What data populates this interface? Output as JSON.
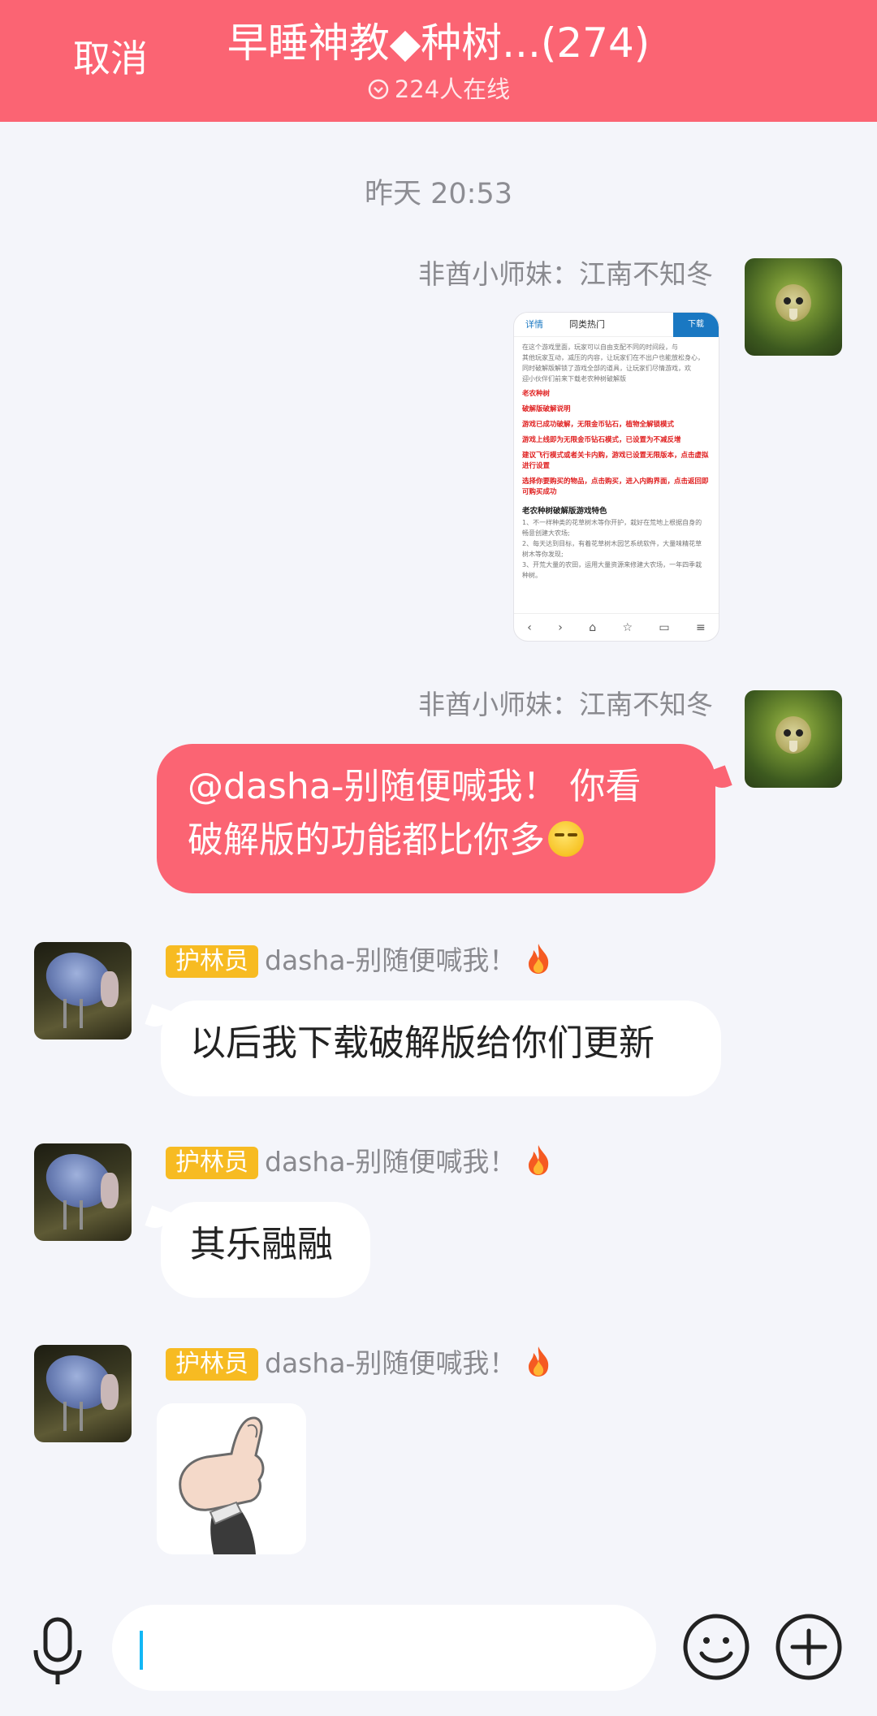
{
  "header": {
    "cancel_label": "取消",
    "title": "早睡神教◆种树...(274)",
    "online": "224人在线"
  },
  "chat": {
    "timestamp": "昨天 20:53",
    "messages": [
      {
        "sender": "非酋小师妹：江南不知冬",
        "type": "image"
      },
      {
        "sender": "非酋小师妹：江南不知冬",
        "text_line1": "@dasha-别随便喊我！ 你看",
        "text_line2": "破解版的功能都比你多"
      },
      {
        "badge": "护林员",
        "sender": "dasha-别随便喊我！",
        "text": "以后我下载破解版给你们更新"
      },
      {
        "badge": "护林员",
        "sender": "dasha-别随便喊我！",
        "text": "其乐融融"
      },
      {
        "badge": "护林员",
        "sender": "dasha-别随便喊我！",
        "type": "sticker"
      }
    ]
  },
  "shared_image": {
    "tab1": "详情",
    "tab2": "同类热门",
    "download": "下载",
    "lines": [
      "在这个游戏里面，玩家可以自由支配不同的时间段，与",
      "其他玩家互动，减压的内容，让玩家们在不出户也能放松身心，",
      "同时破解版解锁了游戏全部的道具，让玩家们尽情游戏，欢",
      "迎小伙伴们前来下载老农种树破解版"
    ],
    "red_lines": [
      "老农种树",
      "破解版破解说明",
      "游戏已成功破解，无限金币钻石，植物全解锁模式",
      "游戏上线即为无限金币钻石模式，已设置为不减反增",
      "建议飞行模式或者关卡内购，游戏已设置无限版本，点击虚拟",
      "进行设置",
      "选择你要购买的物品，点击购买，进入内购界面，点击返回即",
      "可购买成功"
    ],
    "feature_title": "老农种树破解版游戏特色",
    "feature_lines": [
      "1、不一样种类的花草树木等你开护，栽好在荒地上根据自身的",
      "畅意创建大农场;",
      "2、每天达到目标，有着花草树木园艺系统软件，大量味精花草",
      "树木等你发现;",
      "3、开荒大量的农田，运用大量资源来修建大农场，一年四季栽",
      "种树。"
    ]
  },
  "input": {
    "placeholder": ""
  },
  "colors": {
    "brand": "#fb6473",
    "badge": "#f7bb22",
    "caret": "#12b7f5"
  },
  "icons": [
    "check-circle-icon",
    "fire-icon",
    "microphone-icon",
    "smiley-icon",
    "plus-circle-icon"
  ]
}
